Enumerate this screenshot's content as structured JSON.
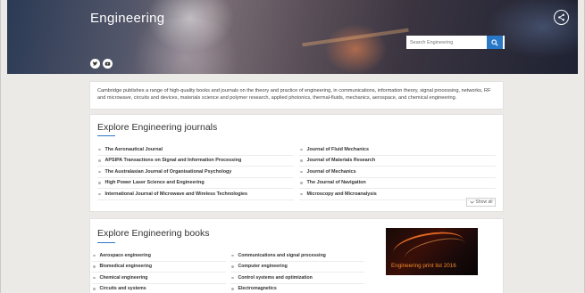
{
  "hero": {
    "title": "Engineering",
    "search_placeholder": "Search Engineering"
  },
  "intro": {
    "text": "Cambridge publishes a range of high-quality books and journals on the theory and practice of engineering, in communications, information theory, signal processing, networks, RF and microwave, circuits and devices, materials science and polymer research, applied photonics, thermal-fluids, mechanics, aerospace, and chemical engineering."
  },
  "journals": {
    "title": "Explore Engineering journals",
    "left": [
      "The Aeronautical Journal",
      "APSIPA Transactions on Signal and Information Processing",
      "The Australasian Journal of Organisational Psychology",
      "High Power Laser Science and Engineering",
      "International Journal of Microwave and Wireless Technologies"
    ],
    "right": [
      "Journal of Fluid Mechanics",
      "Journal of Materials Research",
      "Journal of Mechanics",
      "The Journal of Navigation",
      "Microscopy and Microanalysis"
    ],
    "show_all": "Show all"
  },
  "books": {
    "title": "Explore Engineering books",
    "left": [
      "Aerospace engineering",
      "Biomedical engineering",
      "Chemical engineering",
      "Circuits and systems"
    ],
    "right": [
      "Communications and signal processing",
      "Computer engineering",
      "Control systems and optimization",
      "Electromagnetics"
    ],
    "promo": "Engineering print list 2016"
  },
  "icons": {
    "share": "share-icon",
    "search": "search-icon",
    "twitter": "twitter-icon",
    "youtube": "youtube-icon",
    "show_all": "chevron-down-icon"
  },
  "colors": {
    "accent": "#2a78c8",
    "promo_text": "#f28a2a"
  }
}
